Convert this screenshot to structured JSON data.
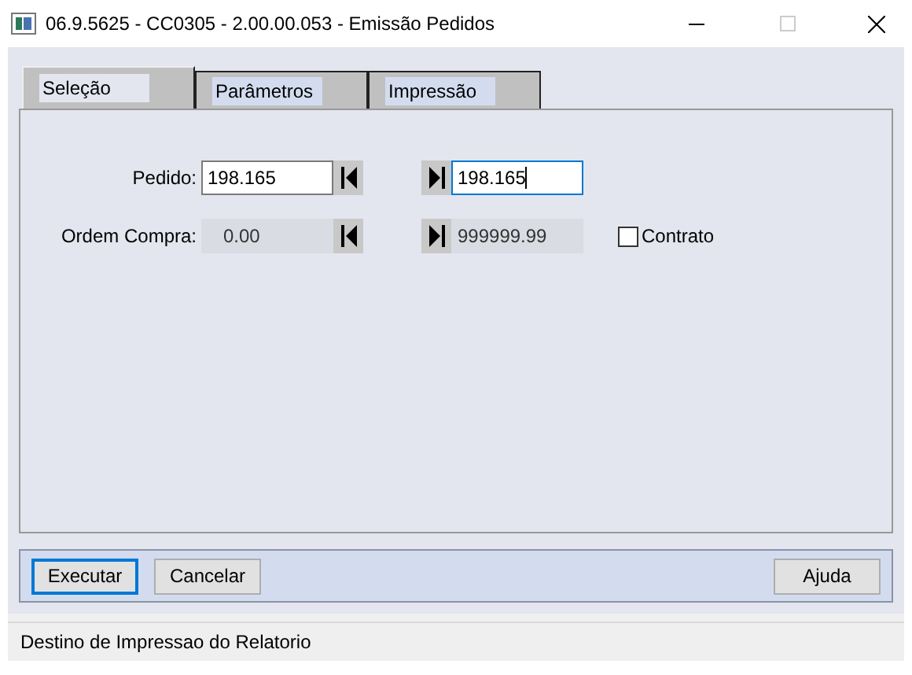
{
  "window": {
    "title": "06.9.5625 - CC0305 - 2.00.00.053 - Emissão Pedidos"
  },
  "tabs": [
    {
      "label": "Seleção",
      "selected": true
    },
    {
      "label": "Parâmetros",
      "selected": false
    },
    {
      "label": "Impressão",
      "selected": false
    }
  ],
  "rows": [
    {
      "label": "Pedido:",
      "from": {
        "value": "198.165",
        "disabled": false,
        "focused": false
      },
      "to": {
        "value": "198.165",
        "disabled": false,
        "focused": true
      }
    },
    {
      "label": "Ordem Compra:",
      "from": {
        "value": "0.00",
        "disabled": true,
        "focused": false
      },
      "to": {
        "value": "999999.99",
        "disabled": true,
        "focused": false
      },
      "checkbox": {
        "label": "Contrato",
        "checked": false
      }
    }
  ],
  "buttons_left": [
    {
      "label": "Executar",
      "focused": true
    },
    {
      "label": "Cancelar",
      "focused": false
    }
  ],
  "buttons_right": [
    {
      "label": "Ajuda",
      "focused": false
    }
  ],
  "status_bar": "Destino de Impressao do Relatorio"
}
